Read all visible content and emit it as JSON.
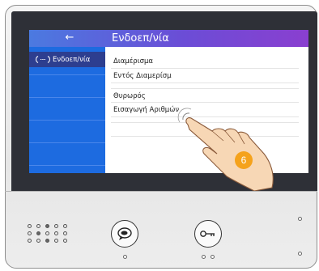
{
  "header": {
    "back_icon": "back-arrow-icon",
    "back_glyph": "←",
    "title": "Ενδοεπ/νία"
  },
  "sidebar": {
    "items": [
      {
        "label": "Ενδοεπ/νία",
        "icon": "intercom-icon"
      }
    ]
  },
  "list": {
    "items": [
      {
        "label": "Διαμέρισμα"
      },
      {
        "label": "Εντός Διαμερίσμ"
      },
      {
        "label": "Θυρωρός"
      },
      {
        "label": "Εισαγωγή Αριθμών"
      }
    ]
  },
  "callout": {
    "step_number": "6"
  },
  "panel": {
    "buttons": [
      {
        "name": "talk-button",
        "icon": "speech-bubble-icon"
      },
      {
        "name": "unlock-button",
        "icon": "key-icon"
      }
    ]
  },
  "colors": {
    "screen_blue": "#1565d6",
    "title_gradient_end": "#8a3fd0",
    "badge_orange": "#f5a21b"
  }
}
